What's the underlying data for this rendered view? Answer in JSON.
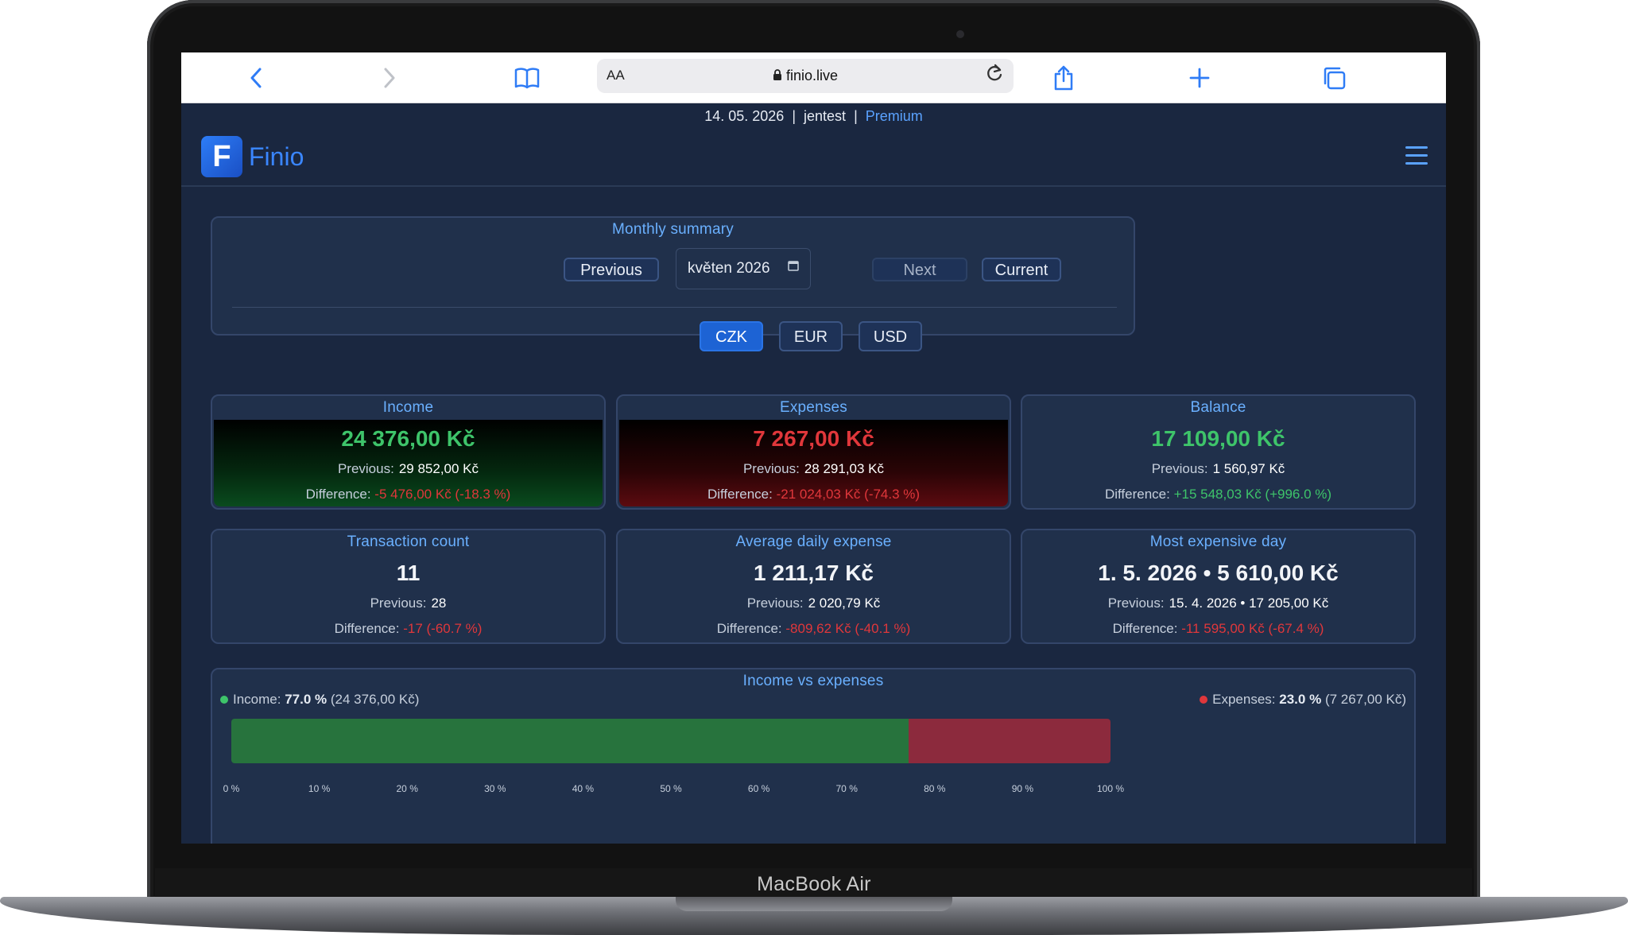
{
  "device": {
    "model_label": "MacBook Air"
  },
  "browser": {
    "address": "finio.live",
    "reader_label": "AA",
    "icons": [
      "back-icon",
      "forward-icon",
      "bookmarks-icon",
      "lock-icon",
      "reload-icon",
      "share-icon",
      "new-tab-icon",
      "tabs-icon"
    ]
  },
  "topline": {
    "date": "14. 05. 2026",
    "sep": "|",
    "user": "jentest",
    "plan": "Premium"
  },
  "brand": {
    "mark": "F",
    "name": "Finio"
  },
  "summary": {
    "title": "Monthly summary",
    "previous_label": "Previous",
    "month_value": "květen 2026",
    "next_label": "Next",
    "current_label": "Current",
    "currencies": [
      "CZK",
      "EUR",
      "USD"
    ],
    "active_currency": "CZK"
  },
  "cards": {
    "income": {
      "title": "Income",
      "value": "24 376,00 Kč",
      "prev_label": "Previous:",
      "prev_value": "29 852,00 Kč",
      "diff_label": "Difference:",
      "diff_value": "-5 476,00 Kč (-18.3 %)"
    },
    "expenses": {
      "title": "Expenses",
      "value": "7 267,00 Kč",
      "prev_label": "Previous:",
      "prev_value": "28 291,03 Kč",
      "diff_label": "Difference:",
      "diff_value": "-21 024,03 Kč (-74.3 %)"
    },
    "balance": {
      "title": "Balance",
      "value": "17 109,00 Kč",
      "prev_label": "Previous:",
      "prev_value": "1 560,97 Kč",
      "diff_label": "Difference:",
      "diff_value": "+15 548,03 Kč (+996.0 %)"
    },
    "count": {
      "title": "Transaction count",
      "value": "11",
      "prev_label": "Previous:",
      "prev_value": "28",
      "diff_label": "Difference:",
      "diff_value": "-17 (-60.7 %)"
    },
    "avg": {
      "title": "Average daily expense",
      "value": "1 211,17 Kč",
      "prev_label": "Previous:",
      "prev_value": "2 020,79 Kč",
      "diff_label": "Difference:",
      "diff_value": "-809,62 Kč (-40.1 %)"
    },
    "maxday": {
      "title": "Most expensive day",
      "value": "1. 5. 2026 • 5 610,00 Kč",
      "prev_label": "Previous:",
      "prev_value": "15. 4. 2026 • 17 205,00 Kč",
      "diff_label": "Difference:",
      "diff_value": "-11 595,00 Kč (-67.4 %)"
    }
  },
  "chart": {
    "title": "Income vs expenses",
    "income_label": "Income:",
    "income_pct": "77.0 %",
    "income_amount": "(24 376,00 Kč)",
    "expenses_label": "Expenses:",
    "expenses_pct": "23.0 %",
    "expenses_amount": "(7 267,00 Kč)"
  },
  "chart_data": {
    "type": "bar",
    "orientation": "horizontal-stacked",
    "title": "Income vs expenses",
    "series": [
      {
        "name": "Income",
        "value": 77.0,
        "color": "#27733d"
      },
      {
        "name": "Expenses",
        "value": 23.0,
        "color": "#8c2a3d"
      }
    ],
    "xlim": [
      0,
      100
    ],
    "x_ticks": [
      "0 %",
      "10 %",
      "20 %",
      "30 %",
      "40 %",
      "50 %",
      "60 %",
      "70 %",
      "80 %",
      "90 %",
      "100 %"
    ],
    "legend": "top"
  },
  "colors": {
    "accent": "#5aa2ff",
    "positive": "#3ec46a",
    "negative": "#e0373b",
    "panel": "#20304b",
    "background": "#1a2740"
  }
}
